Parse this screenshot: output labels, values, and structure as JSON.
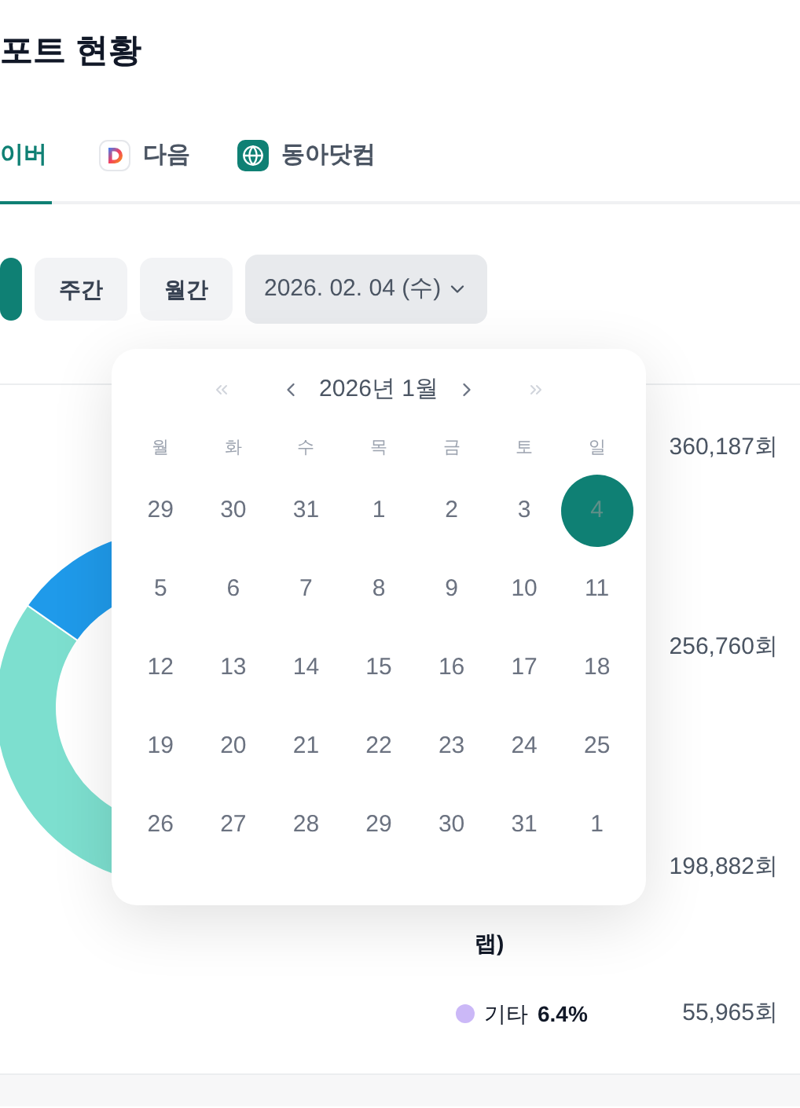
{
  "page_title": "포트 현황",
  "tabs": [
    {
      "label": "이버",
      "selected": true,
      "kind": "plain"
    },
    {
      "label": "다음",
      "selected": false,
      "kind": "daum"
    },
    {
      "label": "동아닷컴",
      "selected": false,
      "kind": "donga"
    }
  ],
  "period_buttons": [
    {
      "selected": true
    },
    {
      "label": "주간",
      "selected": false
    },
    {
      "label": "월간",
      "selected": false
    }
  ],
  "date_picker": {
    "value": "2026. 02. 04 (수)",
    "open": true
  },
  "calendar": {
    "month": "2026년 1월",
    "nav": [
      {
        "kind": "prev_year",
        "disabled": true
      },
      {
        "kind": "prev_month",
        "disabled": false
      },
      {
        "kind": "next_month",
        "disabled": false
      },
      {
        "kind": "next_year",
        "disabled": true
      }
    ],
    "weekdays": [
      "월",
      "화",
      "수",
      "목",
      "금",
      "토",
      "일"
    ],
    "weeks": [
      [
        {
          "day": "29",
          "selected": false
        },
        {
          "day": "30",
          "selected": false
        },
        {
          "day": "31",
          "selected": false
        },
        {
          "day": "1",
          "selected": false
        },
        {
          "day": "2",
          "selected": false
        },
        {
          "day": "3",
          "selected": false
        },
        {
          "day": "4",
          "selected": true
        }
      ],
      [
        {
          "day": "5",
          "selected": false
        },
        {
          "day": "6",
          "selected": false
        },
        {
          "day": "7",
          "selected": false
        },
        {
          "day": "8",
          "selected": false
        },
        {
          "day": "9",
          "selected": false
        },
        {
          "day": "10",
          "selected": false
        },
        {
          "day": "11",
          "selected": false
        }
      ],
      [
        {
          "day": "12",
          "selected": false
        },
        {
          "day": "13",
          "selected": false
        },
        {
          "day": "14",
          "selected": false
        },
        {
          "day": "15",
          "selected": false
        },
        {
          "day": "16",
          "selected": false
        },
        {
          "day": "17",
          "selected": false
        },
        {
          "day": "18",
          "selected": false
        }
      ],
      [
        {
          "day": "19",
          "selected": false
        },
        {
          "day": "20",
          "selected": false
        },
        {
          "day": "21",
          "selected": false
        },
        {
          "day": "22",
          "selected": false
        },
        {
          "day": "23",
          "selected": false
        },
        {
          "day": "24",
          "selected": false
        },
        {
          "day": "25",
          "selected": false
        }
      ],
      [
        {
          "day": "26",
          "selected": false
        },
        {
          "day": "27",
          "selected": false
        },
        {
          "day": "28",
          "selected": false
        },
        {
          "day": "29",
          "selected": false
        },
        {
          "day": "30",
          "selected": false
        },
        {
          "day": "31",
          "selected": false
        },
        {
          "day": "1",
          "selected": false
        }
      ]
    ]
  },
  "stats": {
    "counts": [
      "360,187회",
      "256,760회",
      "198,882회",
      "55,965회"
    ],
    "legend_fragment": "랩)",
    "legend": [
      {
        "label": "기타",
        "percent": "6.4%",
        "color": "#cbb8f7"
      }
    ]
  }
}
